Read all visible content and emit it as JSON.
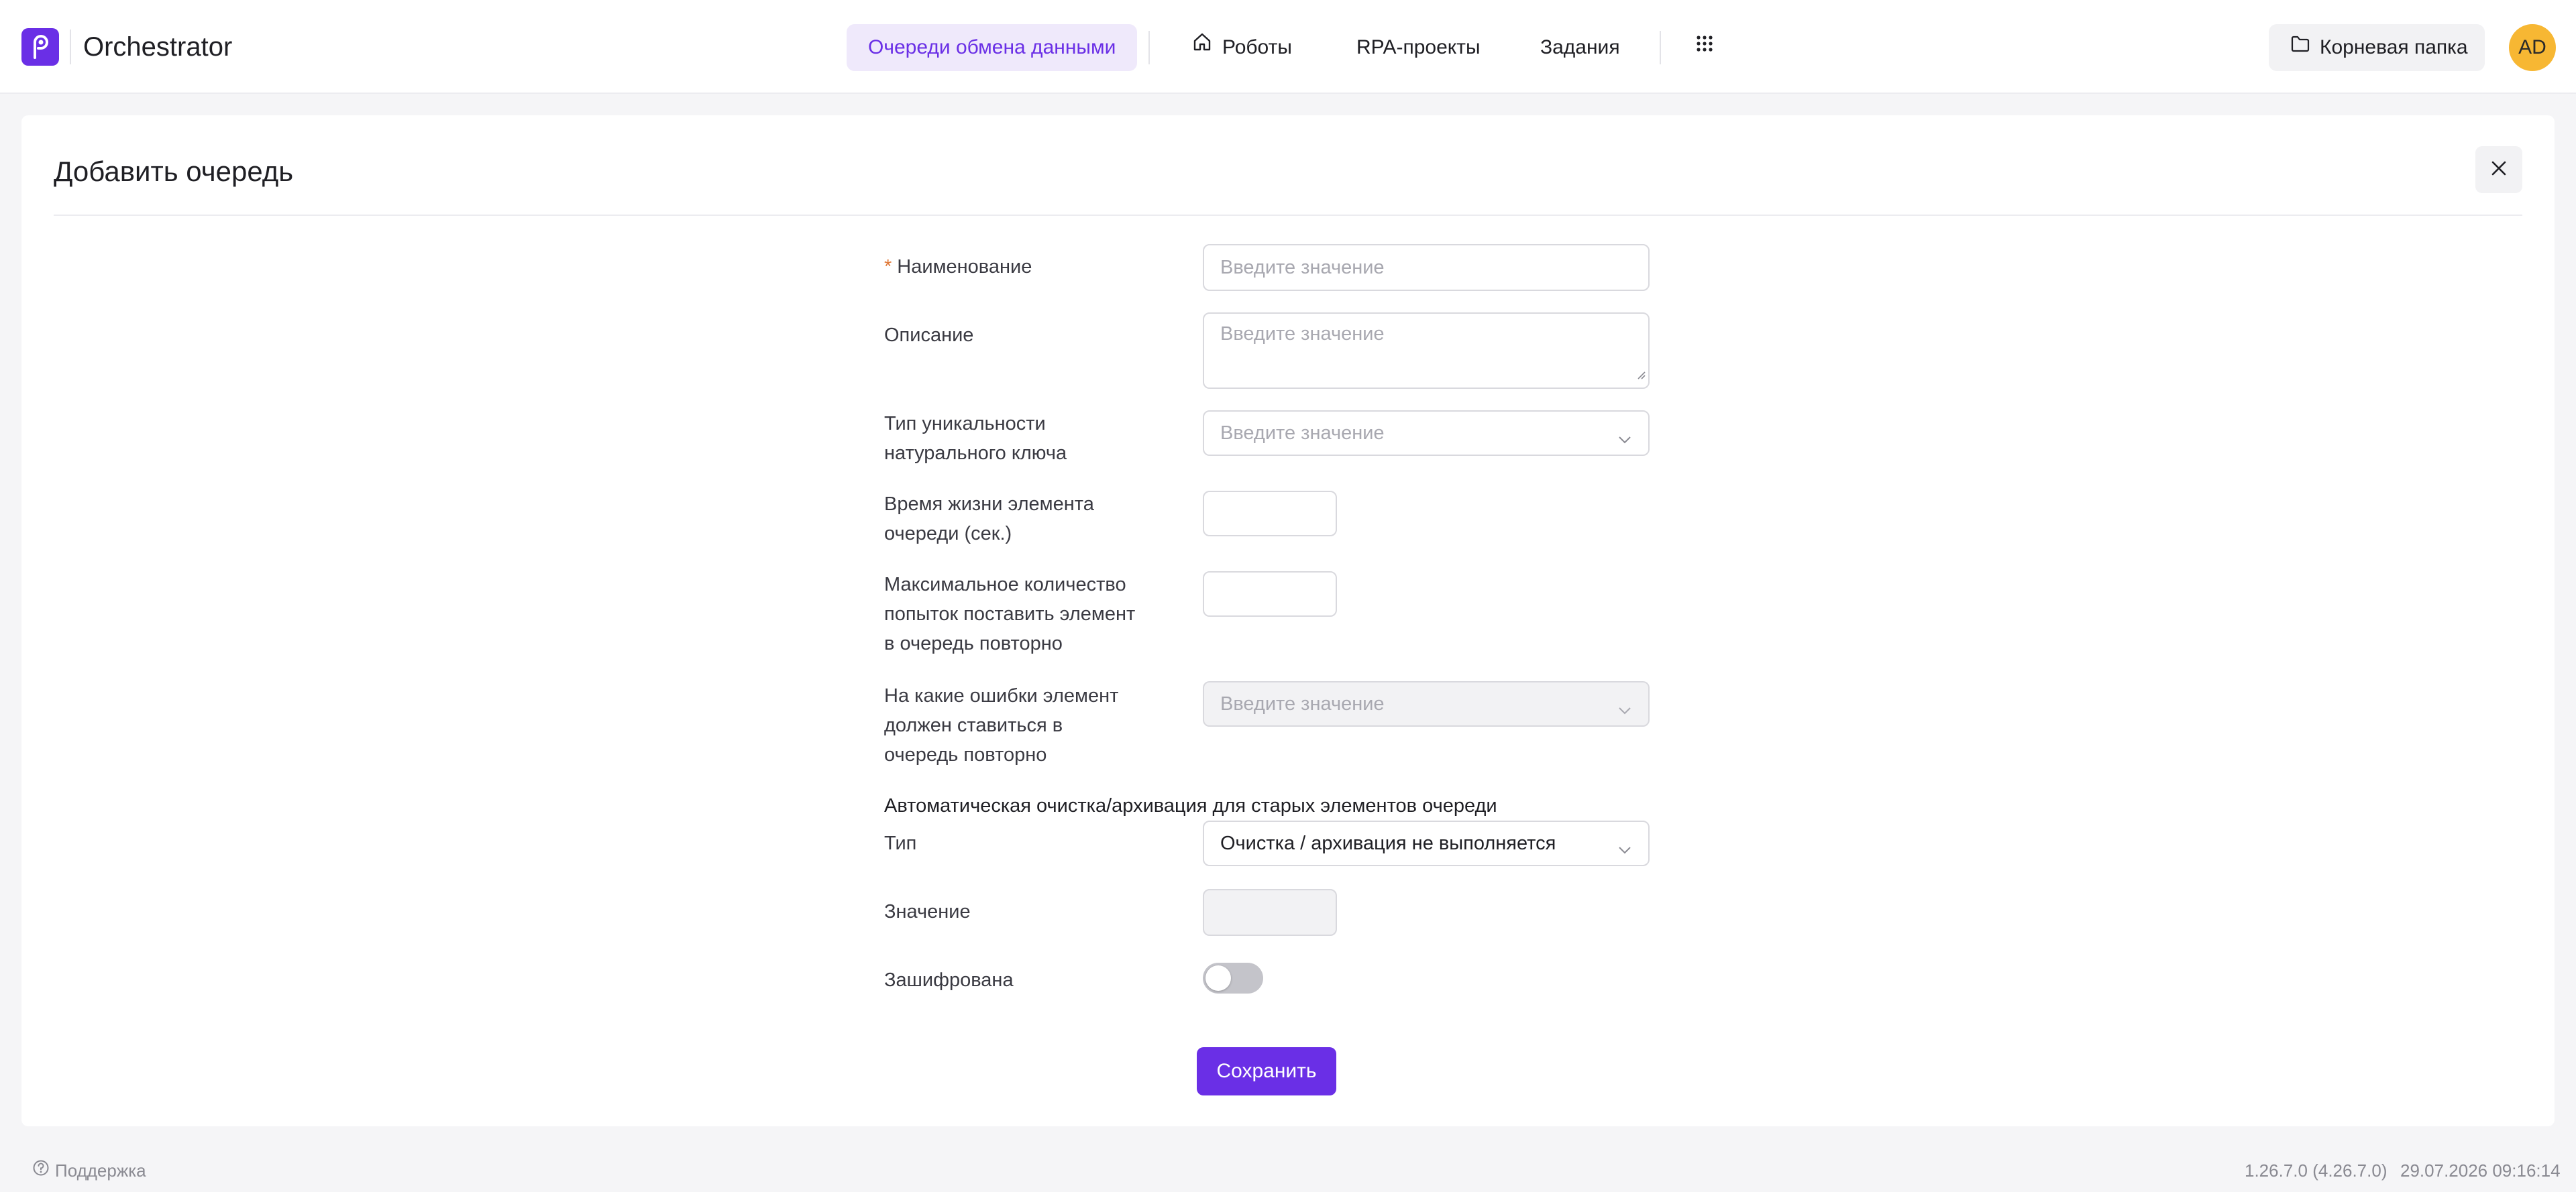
{
  "header": {
    "app_title": "Orchestrator",
    "logo_icon": "orchestrator-logo-icon",
    "nav": [
      {
        "label": "Очереди обмена данными",
        "active": true
      },
      {
        "label": "Роботы",
        "icon": "home-icon"
      },
      {
        "label": "RPA-проекты"
      },
      {
        "label": "Задания"
      }
    ],
    "apps_icon": "grid-icon",
    "folder_button": {
      "label": "Корневая папка",
      "icon": "folder-icon"
    },
    "avatar_initials": "AD"
  },
  "dialog": {
    "title": "Добавить очередь",
    "close_icon": "close-icon",
    "fields": {
      "name": {
        "label": "Наименование",
        "required": true,
        "placeholder": "Введите значение",
        "value": ""
      },
      "description": {
        "label": "Описание",
        "placeholder": "Введите значение",
        "value": ""
      },
      "uniqueness_type": {
        "label_line1": "Тип уникальности",
        "label_line2": "натурального ключа",
        "placeholder": "Введите значение"
      },
      "lifetime": {
        "label_line1": "Время жизни элемента",
        "label_line2": "очереди (сек.)",
        "value": ""
      },
      "max_retries": {
        "label_line1": "Максимальное количество",
        "label_line2": "попыток поставить элемент",
        "label_line3": "в очередь повторно",
        "value": ""
      },
      "retry_errors": {
        "label_line1": "На какие ошибки элемент",
        "label_line2": "должен ставиться в",
        "label_line3": "очередь повторно",
        "placeholder": "Введите значение",
        "disabled": true
      }
    },
    "cleanup_section": {
      "title": "Автоматическая очистка/архивация для старых элементов очереди",
      "type": {
        "label": "Тип",
        "value": "Очистка / архивация не выполняется"
      },
      "value": {
        "label": "Значение",
        "value": "",
        "disabled": true
      }
    },
    "encrypted": {
      "label": "Зашифрована",
      "checked": false
    },
    "save_label": "Сохранить"
  },
  "footer": {
    "support_label": "Поддержка",
    "support_icon": "help-circle-icon",
    "version": "1.26.7.0 (4.26.7.0)",
    "timestamp": "29.07.2026 09:16:14"
  },
  "colors": {
    "accent": "#6a2fe6",
    "accent_light": "#efe9fb",
    "avatar": "#f7b733",
    "required": "#e07a3a",
    "toggle_off": "#c4c4ca"
  }
}
